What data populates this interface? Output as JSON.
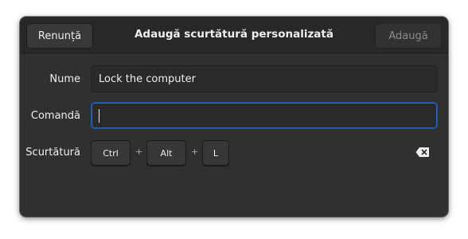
{
  "header": {
    "cancel_label": "Renunță",
    "title": "Adaugă scurtătură personalizată",
    "add_label": "Adaugă"
  },
  "form": {
    "name_label": "Nume",
    "name_value": "Lock the computer",
    "command_label": "Comandă",
    "command_value": "",
    "shortcut_label": "Scurtătură",
    "shortcut_keys": [
      "Ctrl",
      "Alt",
      "L"
    ],
    "separator": "+"
  },
  "icons": {
    "clear": "edit-clear-icon"
  },
  "colors": {
    "focus": "#15539e",
    "background": "#303030",
    "headerbar": "#282828"
  }
}
